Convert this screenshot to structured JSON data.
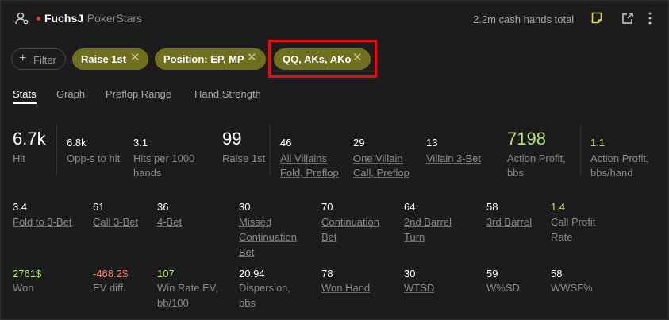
{
  "header": {
    "user_name": "FuchsJ",
    "site_name": ", PokerStars",
    "hands_total": "2.2m cash hands total",
    "icons": [
      "user-settings-icon",
      "note-icon",
      "export-icon",
      "more-icon"
    ],
    "status_color": "#d04040",
    "note_color": "#d8d860"
  },
  "filters": {
    "add_label": "Filter",
    "chips": [
      "Raise 1st",
      "Position: EP, MP",
      "QQ, AKs, AKo"
    ],
    "chip_color": "#6f6f1d"
  },
  "tabs": [
    "Stats",
    "Graph",
    "Preflop Range",
    "Hand Strength"
  ],
  "stats": {
    "row1": [
      {
        "value": "6.7k",
        "label": "Hit"
      },
      {
        "value": "6.8k",
        "label": "Opp-s to hit"
      },
      {
        "value": "3.1",
        "label": "Hits per 1000",
        "label2": "hands"
      },
      {
        "value": "99",
        "label": "Raise 1st"
      },
      {
        "value": "46",
        "label": "All Villains",
        "label2": "Fold, Preflop"
      },
      {
        "value": "29",
        "label": "One Villain",
        "label2": "Call, Preflop"
      },
      {
        "value": "13",
        "label": "Villain 3-Bet"
      },
      {
        "value": "7198",
        "label": "Action Profit,",
        "label2": "bbs"
      },
      {
        "value": "1.1",
        "label": "Action Profit,",
        "label2": "bbs/hand"
      }
    ],
    "row2": [
      {
        "value": "3.4",
        "label": "Fold to 3-Bet"
      },
      {
        "value": "61",
        "label": "Call 3-Bet"
      },
      {
        "value": "36",
        "label": "4-Bet"
      },
      {
        "value": "30",
        "label": "Missed",
        "label2": "Continuation",
        "label3": "Bet"
      },
      {
        "value": "70",
        "label": "Continuation",
        "label2": "Bet"
      },
      {
        "value": "64",
        "label": "2nd Barrel",
        "label2": "Turn"
      },
      {
        "value": "58",
        "label": "3rd Barrel"
      },
      {
        "value": "1.4",
        "label": "Call Profit",
        "label2": "Rate"
      }
    ],
    "row3": [
      {
        "value": "2761$",
        "label": "Won"
      },
      {
        "value": "-468.2$",
        "label": "EV diff."
      },
      {
        "value": "107",
        "label": "Win Rate EV,",
        "label2": "bb/100"
      },
      {
        "value": "20.94",
        "label": "Dispersion,",
        "label2": "bbs"
      },
      {
        "value": "78",
        "label": "Won Hand"
      },
      {
        "value": "30",
        "label": "WTSD"
      },
      {
        "value": "59",
        "label": "W%SD"
      },
      {
        "value": "58",
        "label": "WWSF%"
      }
    ]
  }
}
